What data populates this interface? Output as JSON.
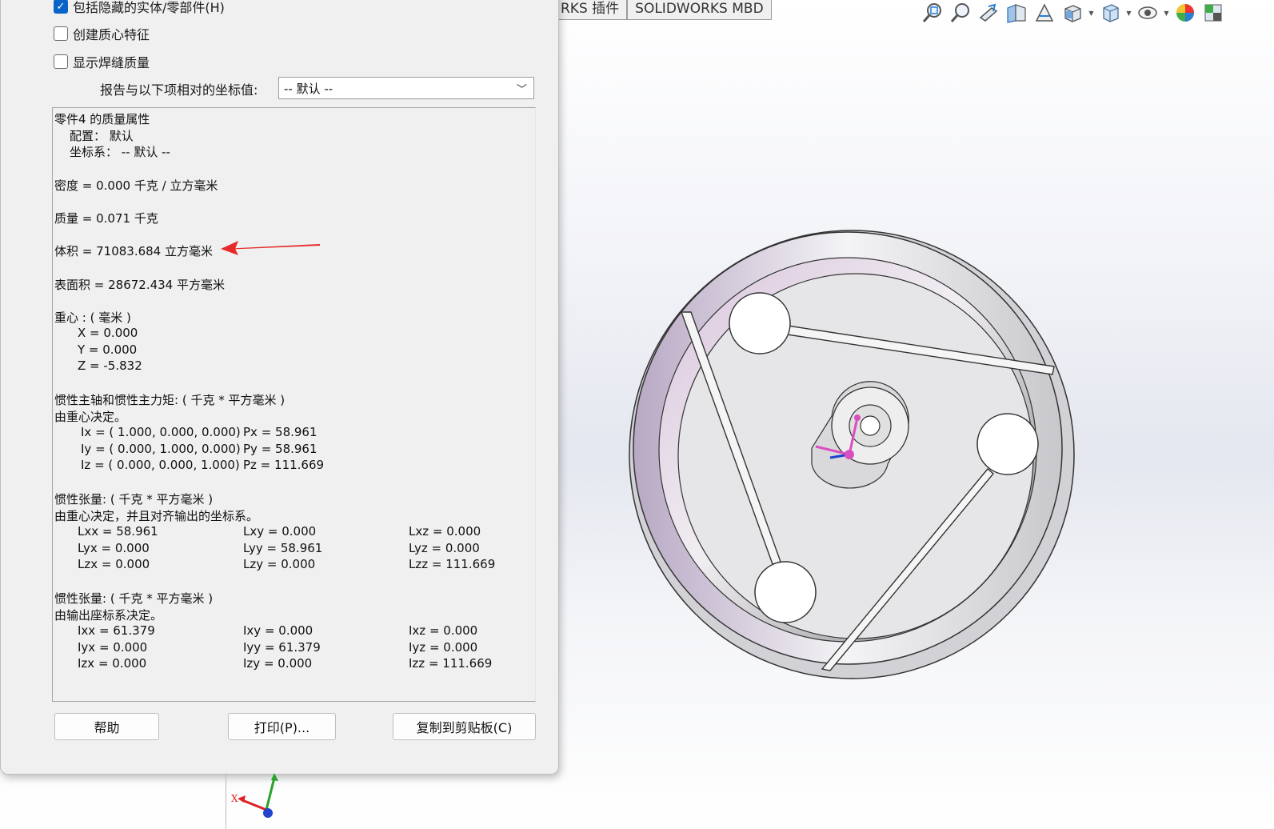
{
  "viewport_tabs": [
    "RKS 插件",
    "SOLIDWORKS MBD"
  ],
  "view_toolbar": {
    "icons": [
      "zoom-to-fit-icon",
      "zoom-to-area-icon",
      "previous-view-icon",
      "section-view-icon",
      "dynamic-annotation-icon",
      "view-orientation-icon",
      "display-style-icon",
      "hide-show-items-icon",
      "edit-appearance-icon",
      "apply-scene-icon"
    ]
  },
  "dialog": {
    "options": [
      {
        "label": "包括隐藏的实体/零部件(H)",
        "checked": true
      },
      {
        "label": "创建质心特征",
        "checked": false
      },
      {
        "label": "显示焊缝质量",
        "checked": false
      }
    ],
    "coord_label": "报告与以下项相对的坐标值:",
    "coord_select_value": "-- 默认 --",
    "results": {
      "title": "零件4 的质量属性",
      "config": "配置： 默认",
      "coord_sys": "坐标系： -- 默认 --",
      "density": "密度 = 0.000 千克 / 立方毫米",
      "mass": "质量 = 0.071 千克",
      "volume": "体积 = 71083.684 立方毫米",
      "surface_area": "表面积 = 28672.434  平方毫米",
      "cog_title": "重心 : ( 毫米 )",
      "cog": [
        "X = 0.000",
        "Y = 0.000",
        "Z = -5.832"
      ],
      "principal_title": "惯性主轴和惯性主力矩: ( 千克 *  平方毫米 )",
      "principal_sub": "由重心决定。",
      "principal_rows": [
        {
          "axis": "Ix = ( 1.000,  0.000,  0.000)",
          "moment": "Px = 58.961"
        },
        {
          "axis": "Iy = ( 0.000,  1.000,  0.000)",
          "moment": "Py = 58.961"
        },
        {
          "axis": "Iz = ( 0.000,  0.000,  1.000)",
          "moment": "Pz = 111.669"
        }
      ],
      "tensor1_title": "惯性张量: ( 千克 *  平方毫米 )",
      "tensor1_sub": "由重心决定，并且对齐输出的坐标系。",
      "tensor1": [
        [
          "Lxx = 58.961",
          "Lxy = 0.000",
          "Lxz = 0.000"
        ],
        [
          "Lyx = 0.000",
          "Lyy = 58.961",
          "Lyz = 0.000"
        ],
        [
          "Lzx = 0.000",
          "Lzy = 0.000",
          "Lzz = 111.669"
        ]
      ],
      "tensor2_title": "惯性张量: ( 千克 *  平方毫米 )",
      "tensor2_sub": "由输出座标系决定。",
      "tensor2": [
        [
          "Ixx = 61.379",
          "Ixy = 0.000",
          "Ixz = 0.000"
        ],
        [
          "Iyx = 0.000",
          "Iyy = 61.379",
          "Iyz = 0.000"
        ],
        [
          "Izx = 0.000",
          "Izy = 0.000",
          "Izz = 111.669"
        ]
      ]
    },
    "buttons": {
      "help": "帮助",
      "print": "打印(P)...",
      "copy": "复制到剪贴板(C)"
    }
  },
  "triad": {
    "x_label": "X"
  }
}
